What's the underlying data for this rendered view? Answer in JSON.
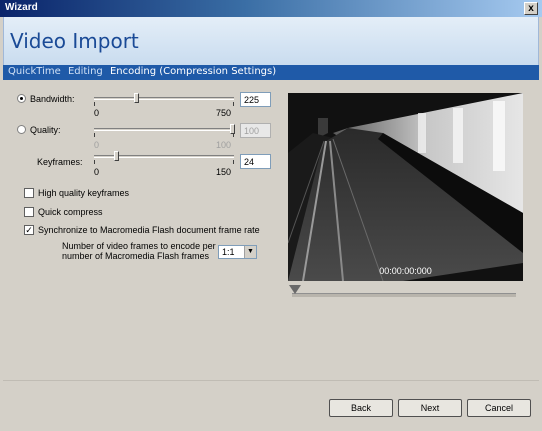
{
  "window": {
    "title": "Wizard",
    "close_glyph": "x"
  },
  "header": {
    "title": "Video Import"
  },
  "breadcrumb": {
    "items": [
      "QuickTime",
      "Editing",
      "Encoding (Compression Settings)"
    ],
    "active_index": 2
  },
  "settings": {
    "bandwidth": {
      "label": "Bandwidth:",
      "min": "0",
      "max": "750",
      "value": "225",
      "selected": true,
      "enabled": true
    },
    "quality": {
      "label": "Quality:",
      "min": "0",
      "max": "100",
      "value": "100",
      "selected": false,
      "enabled": false
    },
    "keyframes": {
      "label": "Keyframes:",
      "min": "0",
      "max": "150",
      "value": "24",
      "enabled": true
    }
  },
  "options": [
    {
      "label": "High quality keyframes",
      "checked": false,
      "check_glyph": ""
    },
    {
      "label": "Quick compress",
      "checked": false,
      "check_glyph": ""
    },
    {
      "label": "Synchronize to Macromedia Flash document frame rate",
      "checked": true,
      "check_glyph": "✓"
    }
  ],
  "frames_encode": {
    "label_line1": "Number of video frames to encode per",
    "label_line2": "number of Macromedia Flash frames",
    "value": "1:1"
  },
  "preview": {
    "timecode": "00:00:00:000"
  },
  "buttons": {
    "back": "Back",
    "next": "Next",
    "cancel": "Cancel"
  },
  "colors": {
    "accent": "#1f5aa8",
    "title_text": "#1a4a96"
  }
}
